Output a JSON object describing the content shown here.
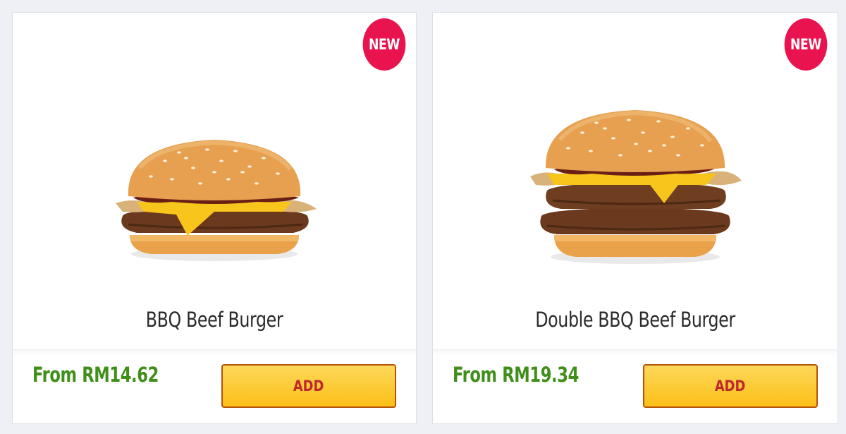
{
  "products": [
    {
      "badge": "NEW",
      "name": "BBQ Beef Burger",
      "price": "From RM14.62",
      "add_label": "ADD",
      "image": "single-patty-bbq-burger"
    },
    {
      "badge": "NEW",
      "name": "Double BBQ Beef Burger",
      "price": "From RM19.34",
      "add_label": "ADD",
      "image": "double-patty-bbq-burger"
    }
  ],
  "colors": {
    "badge": "#e8134f",
    "price": "#3f8f1a",
    "button_bg": "#fbbf17",
    "button_text": "#c0262d"
  }
}
